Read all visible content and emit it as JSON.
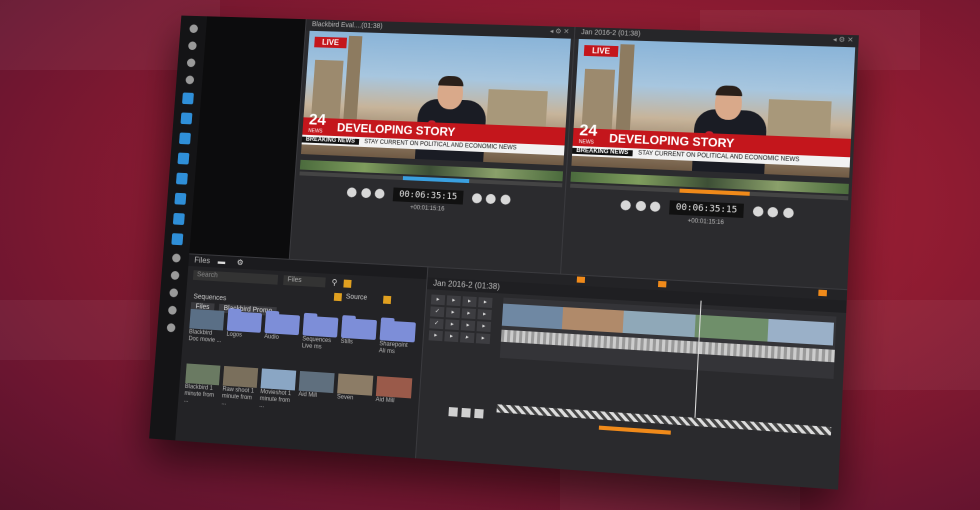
{
  "left_viewer": {
    "title": "Blackbird Eval....(01:38)",
    "live": "LIVE",
    "channel": "24",
    "channel_sub": "NEWS",
    "headline": "DEVELOPING STORY",
    "breaking": "BREAKING NEWS",
    "ticker": "STAY CURRENT ON POLITICAL AND ECONOMIC NEWS",
    "timecode": "00:06:35:15",
    "sub_timecode": "+00:01:15:16"
  },
  "right_viewer": {
    "title": "Jan 2016-2 (01:38)",
    "live": "LIVE",
    "channel": "24",
    "channel_sub": "NEWS",
    "headline": "DEVELOPING STORY",
    "breaking": "BREAKING NEWS",
    "ticker": "STAY CURRENT ON POLITICAL AND ECONOMIC NEWS",
    "timecode": "00:06:35:15",
    "sub_timecode": "+00:01:15:16"
  },
  "files": {
    "panel_title": "Files",
    "search_placeholder": "Search",
    "filter_value": "Files",
    "source_label": "Source",
    "sequences_label": "Sequences",
    "crumbs": [
      "Files",
      "Blackbird Promo"
    ],
    "tiles": [
      {
        "label": "Blackbird Doc movie ...",
        "kind": "thumb"
      },
      {
        "label": "Logos",
        "kind": "folder"
      },
      {
        "label": "Audio",
        "kind": "folder"
      },
      {
        "label": "Sequences Live ms",
        "kind": "folder"
      },
      {
        "label": "Stills",
        "kind": "folder"
      },
      {
        "label": "Sharepoint Ali ms",
        "kind": "folder"
      },
      {
        "label": "Blackbird 1 minute from ...",
        "kind": "thumb"
      },
      {
        "label": "Raw shoot 1 minute from ...",
        "kind": "thumb"
      },
      {
        "label": "Movieshot 1 minute from ...",
        "kind": "thumb"
      },
      {
        "label": "Aid Mill",
        "kind": "thumb"
      },
      {
        "label": "Seven",
        "kind": "thumb"
      },
      {
        "label": "Aid Mill",
        "kind": "thumb"
      }
    ]
  },
  "timeline": {
    "title": "Jan 2016-2 (01:38)",
    "playhead_position": 0.6
  },
  "colors": {
    "accent_red": "#c4161c",
    "accent_orange": "#f08a1a",
    "folder_blue": "#7d8ed8",
    "sidebar_blue": "#2f8fd8"
  }
}
